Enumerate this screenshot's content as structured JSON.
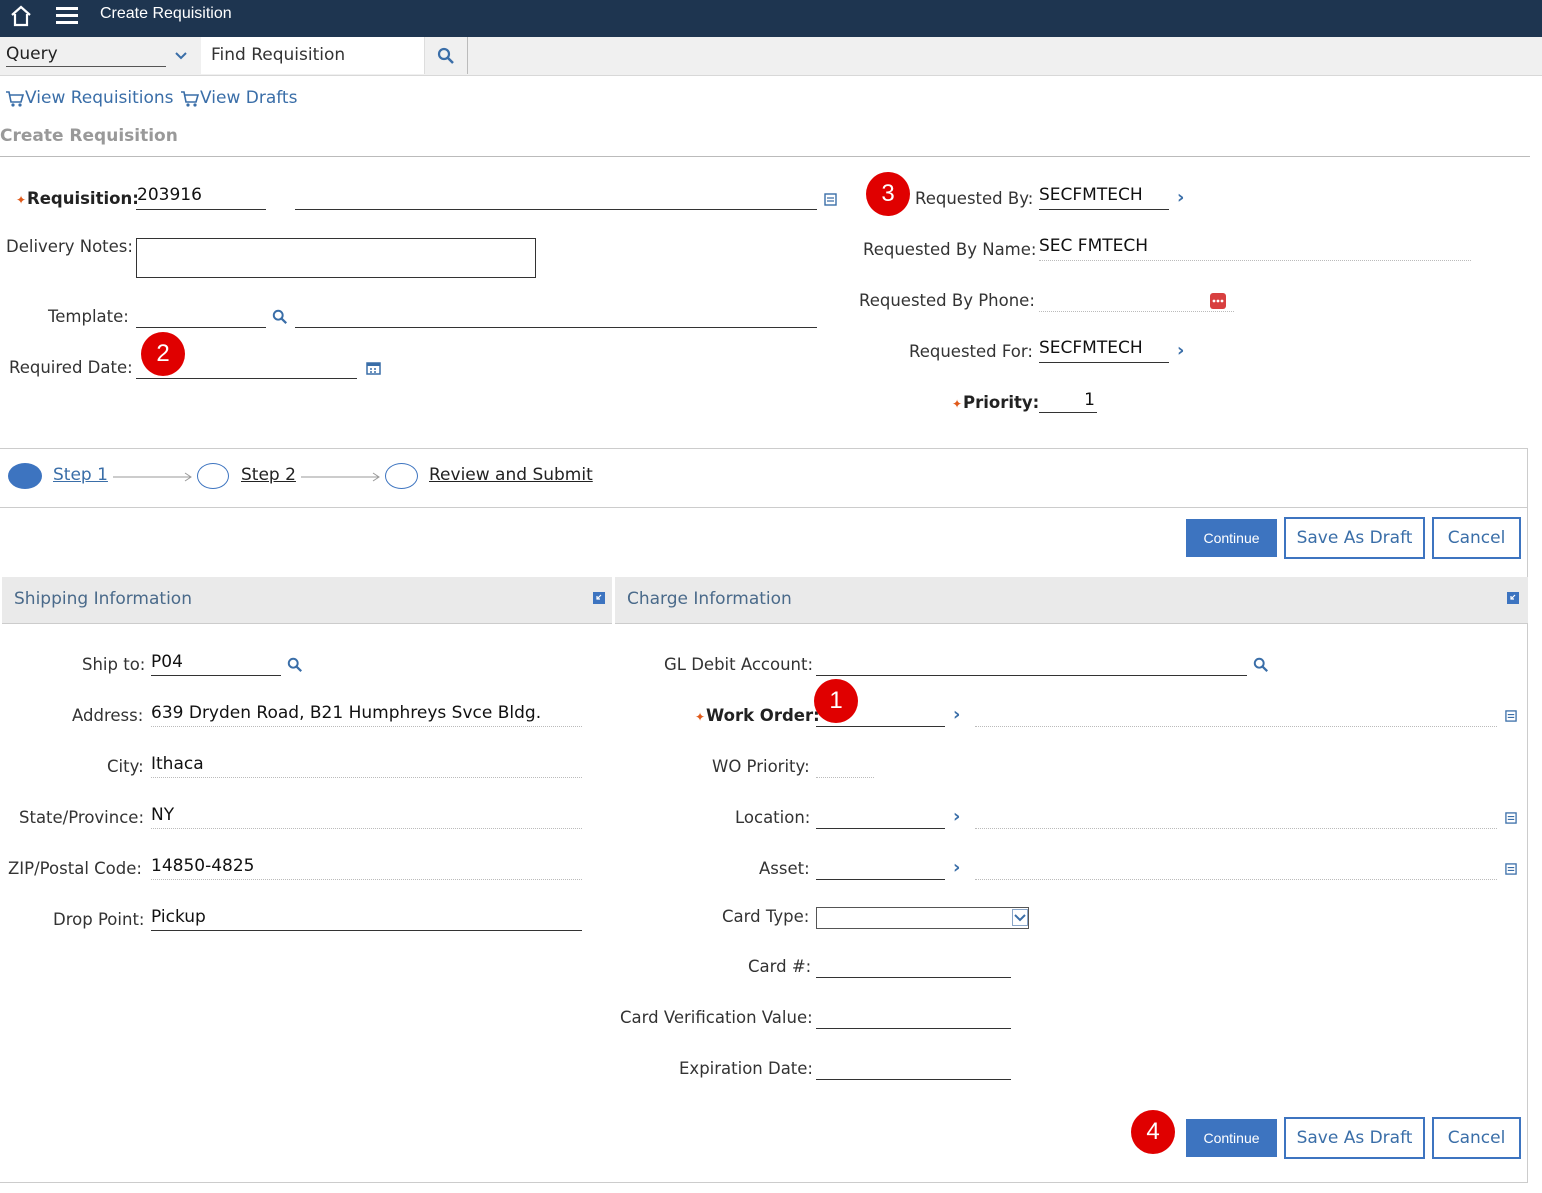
{
  "topbar": {
    "title": "Create Requisition"
  },
  "querybar": {
    "select_value": "Query",
    "find_value": "Find Requisition"
  },
  "actions": {
    "view_requisitions": "View Requisitions",
    "view_drafts": "View Drafts"
  },
  "page_title": "Create Requisition",
  "header_form": {
    "requisition_label": "Requisition:",
    "requisition_value": "203916",
    "delivery_notes_label": "Delivery Notes:",
    "template_label": "Template:",
    "required_date_label": "Required Date:",
    "requested_by_label": "Requested By:",
    "requested_by_value": "SECFMTECH",
    "requested_by_name_label": "Requested By Name:",
    "requested_by_name_value": "SEC FMTECH",
    "requested_by_phone_label": "Requested By Phone:",
    "requested_for_label": "Requested For:",
    "requested_for_value": "SECFMTECH",
    "priority_label": "Priority:",
    "priority_value": "1"
  },
  "steps": {
    "step1": "Step 1",
    "step2": "Step 2",
    "review": "Review and Submit"
  },
  "buttons": {
    "continue": "Continue",
    "save_draft": "Save As Draft",
    "cancel": "Cancel"
  },
  "shipping": {
    "title": "Shipping Information",
    "ship_to_label": "Ship to:",
    "ship_to_value": "P04",
    "address_label": "Address:",
    "address_value": "639 Dryden Road, B21 Humphreys Svce Bldg.",
    "city_label": "City:",
    "city_value": "Ithaca",
    "state_label": "State/Province:",
    "state_value": "NY",
    "zip_label": "ZIP/Postal Code:",
    "zip_value": "14850-4825",
    "drop_label": "Drop Point:",
    "drop_value": "Pickup"
  },
  "charge": {
    "title": "Charge Information",
    "gl_label": "GL Debit Account:",
    "wo_label": "Work Order:",
    "wo_priority_label": "WO Priority:",
    "location_label": "Location:",
    "asset_label": "Asset:",
    "card_type_label": "Card Type:",
    "card_num_label": "Card #:",
    "cvv_label": "Card Verification Value:",
    "exp_label": "Expiration Date:"
  },
  "badges": {
    "b1": "1",
    "b2": "2",
    "b3": "3",
    "b4": "4"
  },
  "colors": {
    "topbar": "#1e3550",
    "accent": "#3d74c0",
    "badge": "#e00000"
  }
}
